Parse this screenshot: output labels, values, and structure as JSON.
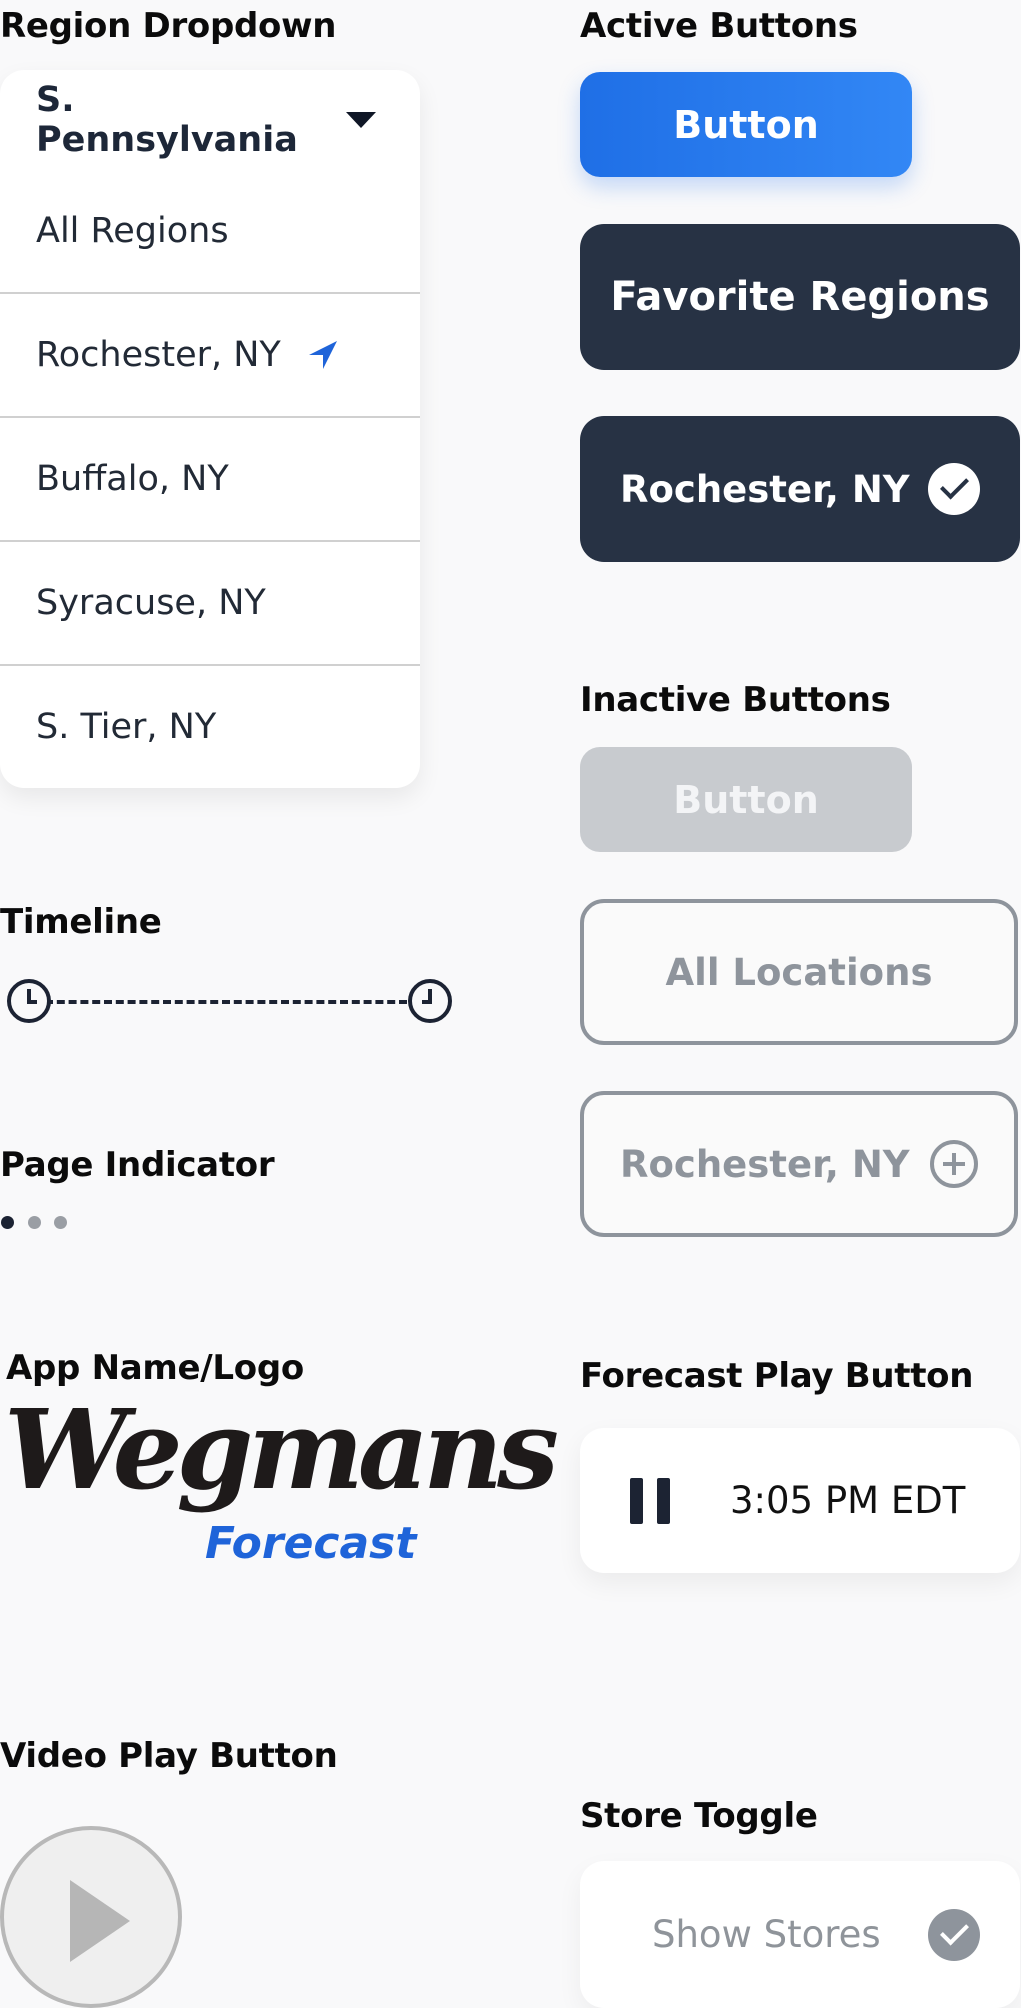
{
  "sections": {
    "region_dropdown": "Region Dropdown",
    "active_buttons": "Active Buttons",
    "inactive_buttons": "Inactive Buttons",
    "timeline": "Timeline",
    "page_indicator": "Page Indicator",
    "app_name_logo": "App Name/Logo",
    "forecast_play_button": "Forecast Play Button",
    "video_play_button": "Video Play Button",
    "store_toggle": "Store Toggle"
  },
  "dropdown": {
    "selected": "S. Pennsylvania",
    "items": [
      {
        "label": "All Regions"
      },
      {
        "label": "Rochester, NY",
        "icon": "location-arrow-icon"
      },
      {
        "label": "Buffalo, NY"
      },
      {
        "label": "Syracuse, NY"
      },
      {
        "label": "S. Tier, NY"
      }
    ]
  },
  "active_buttons": {
    "primary": "Button",
    "favorite_regions": "Favorite Regions",
    "selected_region": "Rochester, NY"
  },
  "inactive_buttons": {
    "disabled": "Button",
    "all_locations": "All Locations",
    "add_region": "Rochester, NY"
  },
  "page_indicator": {
    "count": 3,
    "active": 1
  },
  "logo": {
    "name": "Wegmans",
    "sub": "Forecast"
  },
  "forecast": {
    "time": "3:05 PM EDT",
    "state": "playing"
  },
  "store_toggle": {
    "label": "Show Stores",
    "checked": true
  },
  "colors": {
    "primary": "#1f6fe6",
    "dark": "#273244",
    "disabled": "#c8cbcf",
    "outline": "#8e949c",
    "logo_blue": "#1f64d9"
  }
}
